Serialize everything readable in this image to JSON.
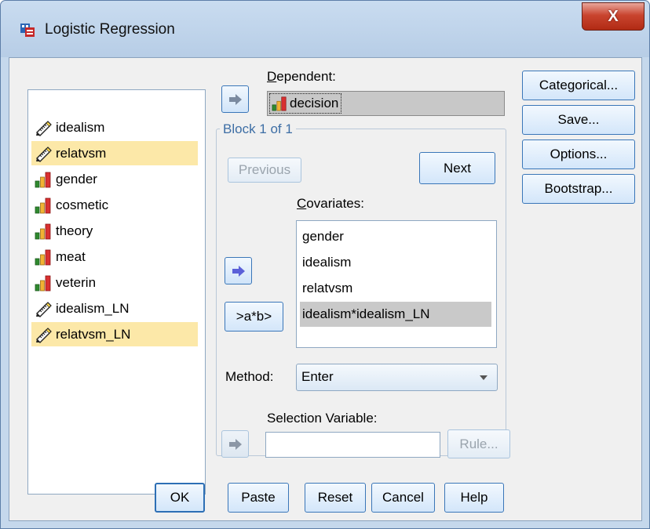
{
  "window": {
    "title": "Logistic Regression",
    "close_label": "X"
  },
  "variables": [
    {
      "name": "idealism",
      "type": "scale",
      "selected": false
    },
    {
      "name": "relatvsm",
      "type": "scale",
      "selected": true
    },
    {
      "name": "gender",
      "type": "nominal",
      "selected": false
    },
    {
      "name": "cosmetic",
      "type": "nominal",
      "selected": false
    },
    {
      "name": "theory",
      "type": "nominal",
      "selected": false
    },
    {
      "name": "meat",
      "type": "nominal",
      "selected": false
    },
    {
      "name": "veterin",
      "type": "nominal",
      "selected": false
    },
    {
      "name": "idealism_LN",
      "type": "scale",
      "selected": false
    },
    {
      "name": "relatvsm_LN",
      "type": "scale",
      "selected": true
    }
  ],
  "dependent": {
    "label": "Dependent:",
    "value": "decision"
  },
  "block": {
    "title": "Block 1 of 1",
    "previous_label": "Previous",
    "next_label": "Next",
    "interaction_label": ">a*b>"
  },
  "covariates": {
    "label": "Covariates:",
    "items": [
      "gender",
      "idealism",
      "relatvsm",
      "idealism*idealism_LN"
    ],
    "selected_index": 3
  },
  "method": {
    "label": "Method:",
    "value": "Enter"
  },
  "selection_variable": {
    "label": "Selection Variable:",
    "value": "",
    "rule_label": "Rule..."
  },
  "side_buttons": [
    "Categorical...",
    "Save...",
    "Options...",
    "Bootstrap..."
  ],
  "bottom_buttons": [
    "OK",
    "Paste",
    "Reset",
    "Cancel",
    "Help"
  ],
  "colors": {
    "selection_yellow": "#fce8a8",
    "selection_gray": "#c9c9c9",
    "group_title": "#3d6ea5",
    "button_border": "#3a76b8"
  }
}
